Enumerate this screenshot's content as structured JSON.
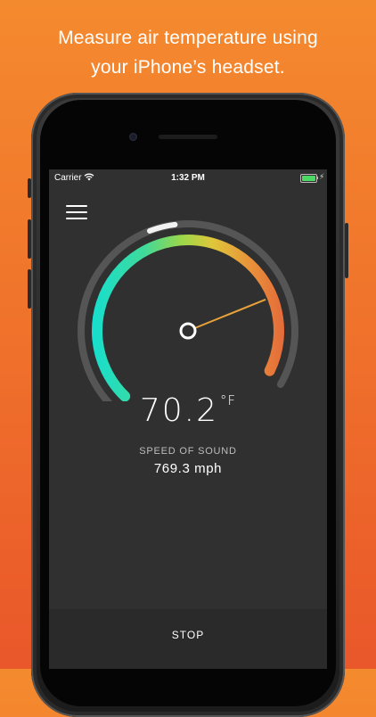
{
  "headline": {
    "line1": "Measure air temperature using",
    "line2": "your iPhone’s headset."
  },
  "status_bar": {
    "carrier": "Carrier",
    "time": "1:32 PM"
  },
  "gauge": {
    "temperature_value": "70.2",
    "temperature_unit": "°F",
    "level": 0.8,
    "colors": [
      "#0fe0d6",
      "#40d99a",
      "#9ad84a",
      "#e0c63a",
      "#e8903a",
      "#e35a3a"
    ]
  },
  "speed_of_sound": {
    "label": "SPEED OF SOUND",
    "value": "769.3 mph"
  },
  "footer": {
    "stop_label": "STOP"
  }
}
